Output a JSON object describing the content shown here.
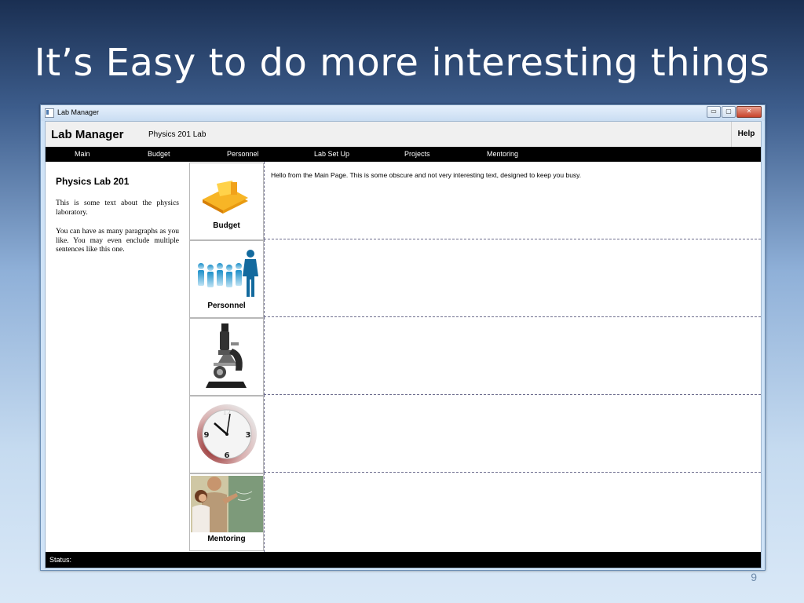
{
  "slide": {
    "title": "It’s Easy to do more interesting things",
    "page_number": "9"
  },
  "window": {
    "title": "Lab Manager",
    "buttons": {
      "minimize": "▭",
      "maximize": "▢",
      "close": "✕"
    }
  },
  "header": {
    "app_name": "Lab Manager",
    "lab_name": "Physics 201 Lab",
    "help_label": "Help"
  },
  "nav": {
    "items": [
      {
        "label": "Main"
      },
      {
        "label": "Budget"
      },
      {
        "label": "Personnel"
      },
      {
        "label": "Lab Set Up"
      },
      {
        "label": "Projects"
      },
      {
        "label": "Mentoring"
      }
    ]
  },
  "sidebar": {
    "heading": "Physics Lab 201",
    "paragraphs": [
      "This is some text about the physics laboratory.",
      "You can have as many paragraphs as you like. You may even enclude multiple sentences like this one."
    ]
  },
  "tiles": [
    {
      "label": "Budget",
      "icon": "budget-icon"
    },
    {
      "label": "Personnel",
      "icon": "personnel-icon"
    },
    {
      "label": "",
      "icon": "microscope-icon"
    },
    {
      "label": "",
      "icon": "clock-icon"
    },
    {
      "label": "Mentoring",
      "icon": "mentoring-photo"
    }
  ],
  "main": {
    "text": "Hello from the Main Page. This is some obscure and not very interesting text, designed to keep you busy."
  },
  "status": {
    "label": "Status:"
  },
  "colors": {
    "nav_bg": "#000000",
    "header_bg": "#f0f0f0",
    "budget_icon": "#f5b01a"
  }
}
